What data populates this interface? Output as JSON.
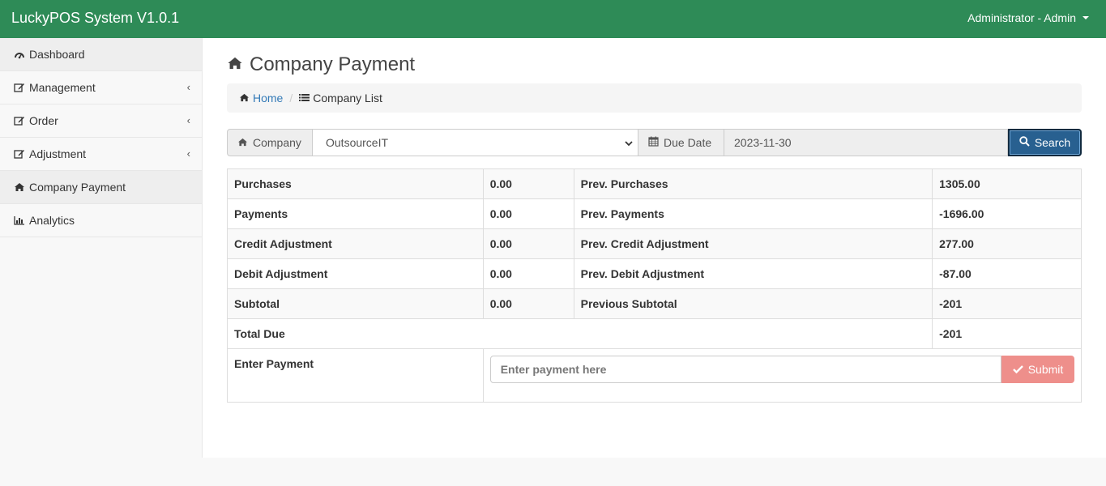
{
  "app": {
    "title": "LuckyPOS System V1.0.1",
    "user": "Administrator - Admin"
  },
  "sidebar": {
    "items": [
      {
        "label": "Dashboard",
        "icon": "dashboard-icon"
      },
      {
        "label": "Management",
        "icon": "edit-icon",
        "submenu": true
      },
      {
        "label": "Order",
        "icon": "edit-icon",
        "submenu": true
      },
      {
        "label": "Adjustment",
        "icon": "edit-icon",
        "submenu": true
      },
      {
        "label": "Company Payment",
        "icon": "home-icon"
      },
      {
        "label": "Analytics",
        "icon": "bar-chart-icon"
      }
    ]
  },
  "page": {
    "title": "Company Payment"
  },
  "breadcrumb": {
    "home": "Home",
    "current": "Company List"
  },
  "search": {
    "company_label": "Company",
    "company_value": "OutsourceIT",
    "due_date_label": "Due Date",
    "due_date_value": "2023-11-30",
    "button_label": "Search"
  },
  "summary": {
    "rows": [
      {
        "label": "Purchases",
        "value": "0.00",
        "prev_label": "Prev. Purchases",
        "prev_value": "1305.00"
      },
      {
        "label": "Payments",
        "value": "0.00",
        "prev_label": "Prev. Payments",
        "prev_value": "-1696.00"
      },
      {
        "label": "Credit Adjustment",
        "value": "0.00",
        "prev_label": "Prev. Credit Adjustment",
        "prev_value": "277.00"
      },
      {
        "label": "Debit Adjustment",
        "value": "0.00",
        "prev_label": "Prev. Debit Adjustment",
        "prev_value": "-87.00"
      },
      {
        "label": "Subtotal",
        "value": "0.00",
        "prev_label": "Previous Subtotal",
        "prev_value": "-201"
      }
    ],
    "total_due_label": "Total Due",
    "total_due_value": "-201",
    "enter_payment_label": "Enter Payment",
    "payment_placeholder": "Enter payment here",
    "submit_label": "Submit"
  },
  "colors": {
    "navbar": "#2e8b57",
    "search_button": "#286090",
    "submit_button": "#ee8f8b",
    "link": "#337ab7"
  }
}
